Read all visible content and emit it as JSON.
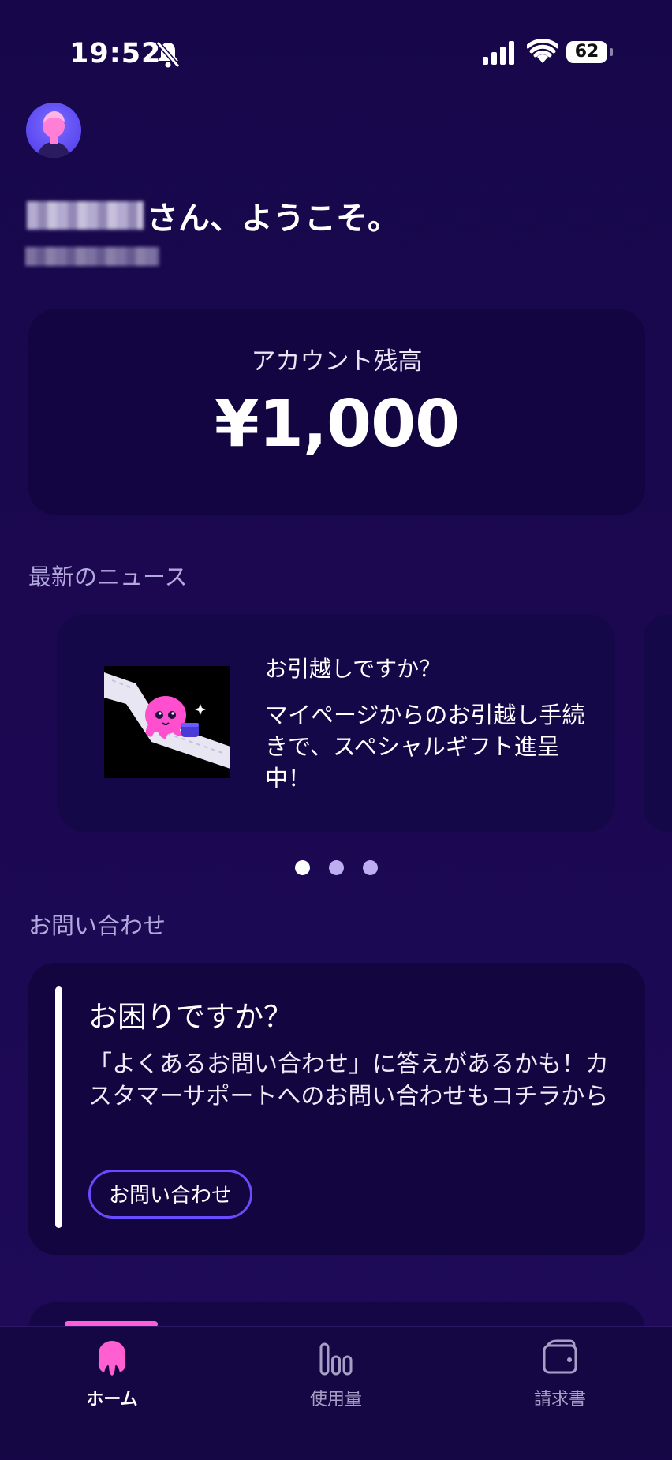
{
  "status_bar": {
    "time": "19:52",
    "battery": "62"
  },
  "greeting": {
    "suffix": "さん、ようこそ。"
  },
  "balance": {
    "label": "アカウント残高",
    "value": "¥1,000"
  },
  "news": {
    "section_title": "最新のニュース",
    "items": [
      {
        "title": "お引越しですか？",
        "body": "マイページからのお引越し手続きで、スペシャルギフト進呈中！"
      }
    ],
    "pager": {
      "count": 3,
      "active_index": 0
    }
  },
  "contact": {
    "section_title": "お問い合わせ",
    "title": "お困りですか？",
    "body": "「よくあるお問い合わせ」に答えがあるかも！カスタマーサポートへのお問い合わせもコチラから",
    "button_label": "お問い合わせ"
  },
  "tabbar": {
    "tabs": [
      {
        "label": "ホーム",
        "icon": "octopus-icon",
        "active": true
      },
      {
        "label": "使用量",
        "icon": "bar-chart-icon",
        "active": false
      },
      {
        "label": "請求書",
        "icon": "wallet-icon",
        "active": false
      }
    ]
  },
  "colors": {
    "background": "#1b0850",
    "card": "#130541",
    "accent_pink": "#ff5fd0",
    "accent_purple": "#6a4cff"
  }
}
